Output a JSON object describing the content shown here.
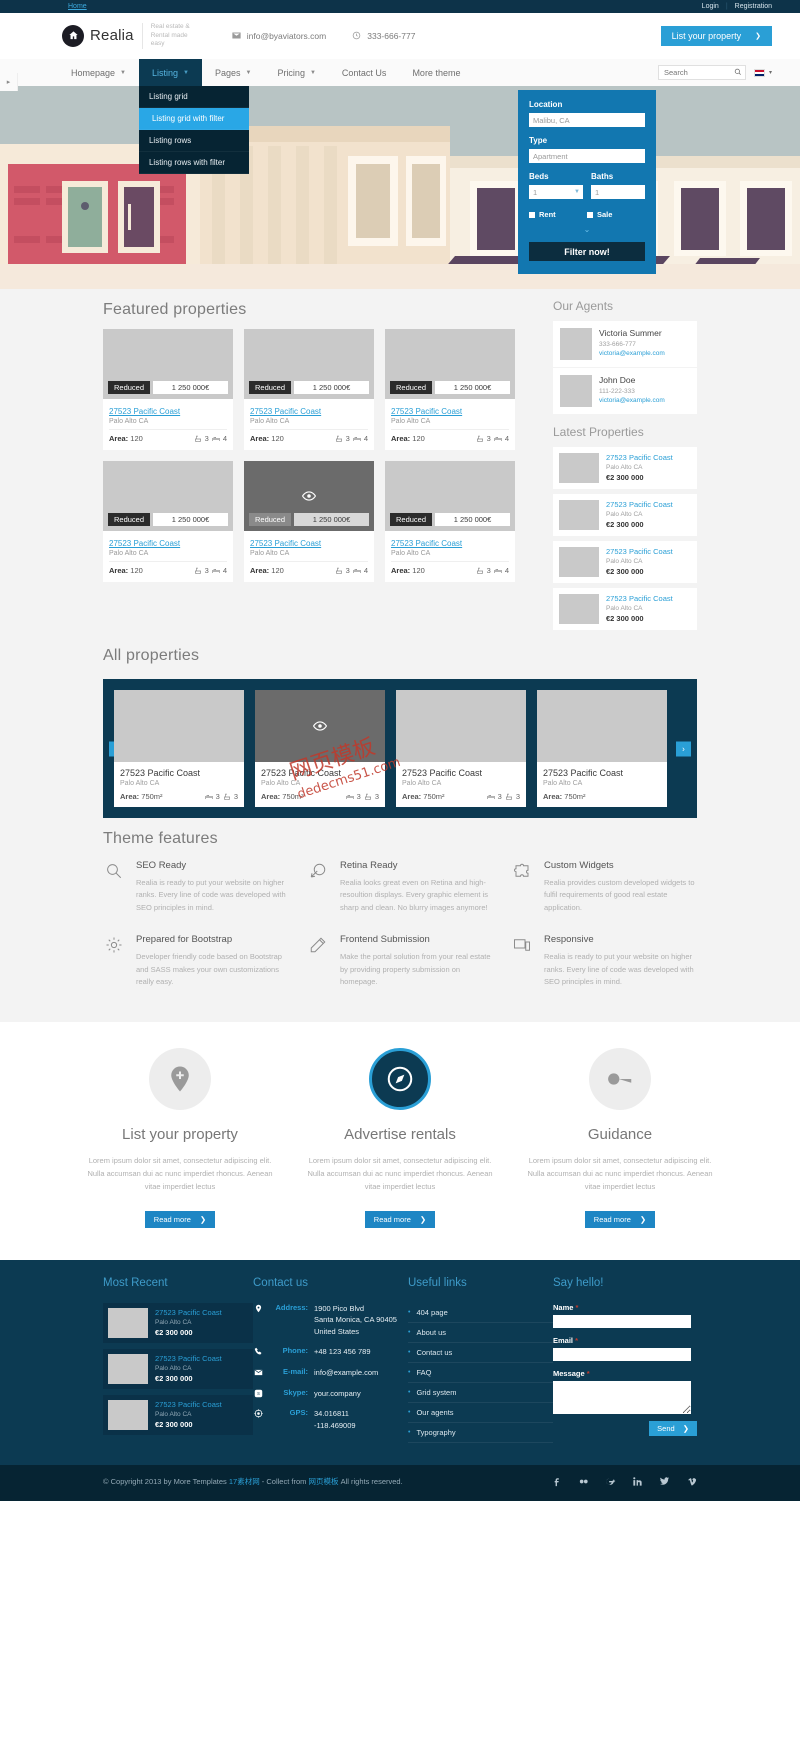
{
  "topbar": {
    "home": "Home",
    "login": "Login",
    "separator": "|",
    "registration": "Registration"
  },
  "header": {
    "brand_name": "Realia",
    "brand_tagline": "Real estate & Rental made easy",
    "email": "info@byaviators.com",
    "phone": "333-666-777",
    "cta_label": "List your property",
    "cta_arrow": "❯"
  },
  "nav": {
    "items": [
      {
        "label": "Homepage",
        "has_caret": true
      },
      {
        "label": "Listing",
        "has_caret": true,
        "active": true
      },
      {
        "label": "Pages",
        "has_caret": true
      },
      {
        "label": "Pricing",
        "has_caret": true
      },
      {
        "label": "Contact Us",
        "has_caret": false
      },
      {
        "label": "More theme",
        "has_caret": false
      }
    ],
    "dropdown": [
      {
        "label": "Listing grid",
        "selected": false
      },
      {
        "label": "Listing grid with filter",
        "selected": true
      },
      {
        "label": "Listing rows",
        "selected": false
      },
      {
        "label": "Listing rows with filter",
        "selected": false
      }
    ],
    "search_placeholder": "Search",
    "lang_caret": "▾"
  },
  "filter": {
    "location_label": "Location",
    "location_value": "Malibu, CA",
    "type_label": "Type",
    "type_value": "Apartment",
    "beds_label": "Beds",
    "beds_value": "1",
    "baths_label": "Baths",
    "baths_value": "1",
    "rent_label": "Rent",
    "sale_label": "Sale",
    "more_toggle": "⌄",
    "button_label": "Filter now!"
  },
  "featured": {
    "title": "Featured properties",
    "cards": [
      {
        "badge": "Reduced",
        "price": "1 250 000€",
        "address": "27523 Pacific Coast",
        "city": "Palo Alto CA",
        "area_label": "Area:",
        "area": "120",
        "baths": "3",
        "beds": "4",
        "hover": false
      },
      {
        "badge": "Reduced",
        "price": "1 250 000€",
        "address": "27523 Pacific Coast",
        "city": "Palo Alto CA",
        "area_label": "Area:",
        "area": "120",
        "baths": "3",
        "beds": "4",
        "hover": false
      },
      {
        "badge": "Reduced",
        "price": "1 250 000€",
        "address": "27523 Pacific Coast",
        "city": "Palo Alto CA",
        "area_label": "Area:",
        "area": "120",
        "baths": "3",
        "beds": "4",
        "hover": false
      },
      {
        "badge": "Reduced",
        "price": "1 250 000€",
        "address": "27523 Pacific Coast",
        "city": "Palo Alto CA",
        "area_label": "Area:",
        "area": "120",
        "baths": "3",
        "beds": "4",
        "hover": false
      },
      {
        "badge": "Reduced",
        "price": "1 250 000€",
        "address": "27523 Pacific Coast",
        "city": "Palo Alto CA",
        "area_label": "Area:",
        "area": "120",
        "baths": "3",
        "beds": "4",
        "hover": true
      },
      {
        "badge": "Reduced",
        "price": "1 250 000€",
        "address": "27523 Pacific Coast",
        "city": "Palo Alto CA",
        "area_label": "Area:",
        "area": "120",
        "baths": "3",
        "beds": "4",
        "hover": false
      }
    ]
  },
  "agents": {
    "title": "Our Agents",
    "items": [
      {
        "name": "Victoria Summer",
        "phone": "333-666-777",
        "email": "victoria@example.com"
      },
      {
        "name": "John Doe",
        "phone": "111-222-333",
        "email": "victoria@example.com"
      }
    ]
  },
  "latest": {
    "title": "Latest Properties",
    "items": [
      {
        "address": "27523 Pacific Coast",
        "city": "Palo Alto CA",
        "price": "€2 300 000"
      },
      {
        "address": "27523 Pacific Coast",
        "city": "Palo Alto CA",
        "price": "€2 300 000"
      },
      {
        "address": "27523 Pacific Coast",
        "city": "Palo Alto CA",
        "price": "€2 300 000"
      },
      {
        "address": "27523 Pacific Coast",
        "city": "Palo Alto CA",
        "price": "€2 300 000"
      }
    ]
  },
  "all_properties": {
    "title": "All properties",
    "prev_arrow": "‹",
    "next_arrow": "›",
    "cards": [
      {
        "address": "27523 Pacific Coast",
        "city": "Palo Alto CA",
        "area_label": "Area:",
        "area": "750m²",
        "beds": "3",
        "baths": "3",
        "hover": false
      },
      {
        "address": "27523 Pacific Coast",
        "city": "Palo Alto CA",
        "area_label": "Area:",
        "area": "750m²",
        "beds": "3",
        "baths": "3",
        "hover": true
      },
      {
        "address": "27523 Pacific Coast",
        "city": "Palo Alto CA",
        "area_label": "Area:",
        "area": "750m²",
        "beds": "3",
        "baths": "3",
        "hover": false
      },
      {
        "address": "27523 Pacific Coast",
        "city": "Palo Alto CA",
        "area_label": "Area:",
        "area": "750m²",
        "beds": "3",
        "baths": "3",
        "hover": false
      }
    ]
  },
  "theme_features": {
    "title": "Theme features",
    "items": [
      {
        "icon": "magnifier-icon",
        "title": "SEO Ready",
        "text": "Realia is ready to put your website on higher ranks. Every line of code was developed with SEO principles in mind."
      },
      {
        "icon": "retina-icon",
        "title": "Retina Ready",
        "text": "Realia looks great even on Retina and high-resoultion displays. Every graphic element is sharp and clean. No blurry images anymore!"
      },
      {
        "icon": "puzzle-icon",
        "title": "Custom Widgets",
        "text": "Realia provides custom developed widgets to fulfil requirements of good real estate application."
      },
      {
        "icon": "gear-icon",
        "title": "Prepared for Bootstrap",
        "text": "Developer friendly code based on Bootstrap and SASS makes your own customizations really easy."
      },
      {
        "icon": "pencil-icon",
        "title": "Frontend Submission",
        "text": "Make the portal solution from your real estate by providing property submission on homepage."
      },
      {
        "icon": "responsive-icon",
        "title": "Responsive",
        "text": "Realia is ready to put your website on higher ranks. Every line of code was developed with SEO principles in mind."
      }
    ]
  },
  "promos": [
    {
      "icon": "map-pin-plus-icon",
      "title": "List your property",
      "text": "Lorem ipsum dolor sit amet, consectetur adipiscing elit. Nulla accumsan dui ac nunc imperdiet rhoncus. Aenean vitae imperdiet lectus",
      "button": "Read more",
      "arrow": "❯",
      "highlight": false
    },
    {
      "icon": "compass-icon",
      "title": "Advertise rentals",
      "text": "Lorem ipsum dolor sit amet, consectetur adipiscing elit. Nulla accumsan dui ac nunc imperdiet rhoncus. Aenean vitae imperdiet lectus",
      "button": "Read more",
      "arrow": "❯",
      "highlight": true
    },
    {
      "icon": "key-icon",
      "title": "Guidance",
      "text": "Lorem ipsum dolor sit amet, consectetur adipiscing elit. Nulla accumsan dui ac nunc imperdiet rhoncus. Aenean vitae imperdiet lectus",
      "button": "Read more",
      "arrow": "❯",
      "highlight": false
    }
  ],
  "footer": {
    "most_recent": {
      "title": "Most Recent",
      "items": [
        {
          "address": "27523 Pacific Coast",
          "city": "Palo Alto CA",
          "price": "€2 300 000"
        },
        {
          "address": "27523 Pacific Coast",
          "city": "Palo Alto CA",
          "price": "€2 300 000"
        },
        {
          "address": "27523 Pacific Coast",
          "city": "Palo Alto CA",
          "price": "€2 300 000"
        }
      ]
    },
    "contact": {
      "title": "Contact us",
      "address_label": "Address:",
      "address_value": "1900 Pico Blvd\nSanta Monica, CA 90405\nUnited States",
      "phone_label": "Phone:",
      "phone_value": "+48 123 456 789",
      "email_label": "E-mail:",
      "email_value": "info@example.com",
      "skype_label": "Skype:",
      "skype_value": "your.company",
      "gps_label": "GPS:",
      "gps_value": "34.016811\n-118.469009"
    },
    "useful": {
      "title": "Useful links",
      "links": [
        "404 page",
        "About us",
        "Contact us",
        "FAQ",
        "Grid system",
        "Our agents",
        "Typography"
      ]
    },
    "form": {
      "title": "Say hello!",
      "name_label": "Name",
      "email_label": "Email",
      "message_label": "Message",
      "required_mark": "*",
      "send_label": "Send",
      "send_arrow": "❯"
    },
    "bottom": {
      "copyright_pre": "© Copyright 2013 by More Templates ",
      "link1": "17素材网",
      "copyright_mid": " - Collect from ",
      "link2": "网页模板",
      "copyright_post": " All rights reserved.",
      "socials": [
        "facebook-icon",
        "flickr-icon",
        "google-plus-icon",
        "linkedin-icon",
        "twitter-icon",
        "vimeo-icon"
      ]
    }
  },
  "watermark": {
    "line1": "网页模板",
    "line2": "dedecms51.com"
  }
}
